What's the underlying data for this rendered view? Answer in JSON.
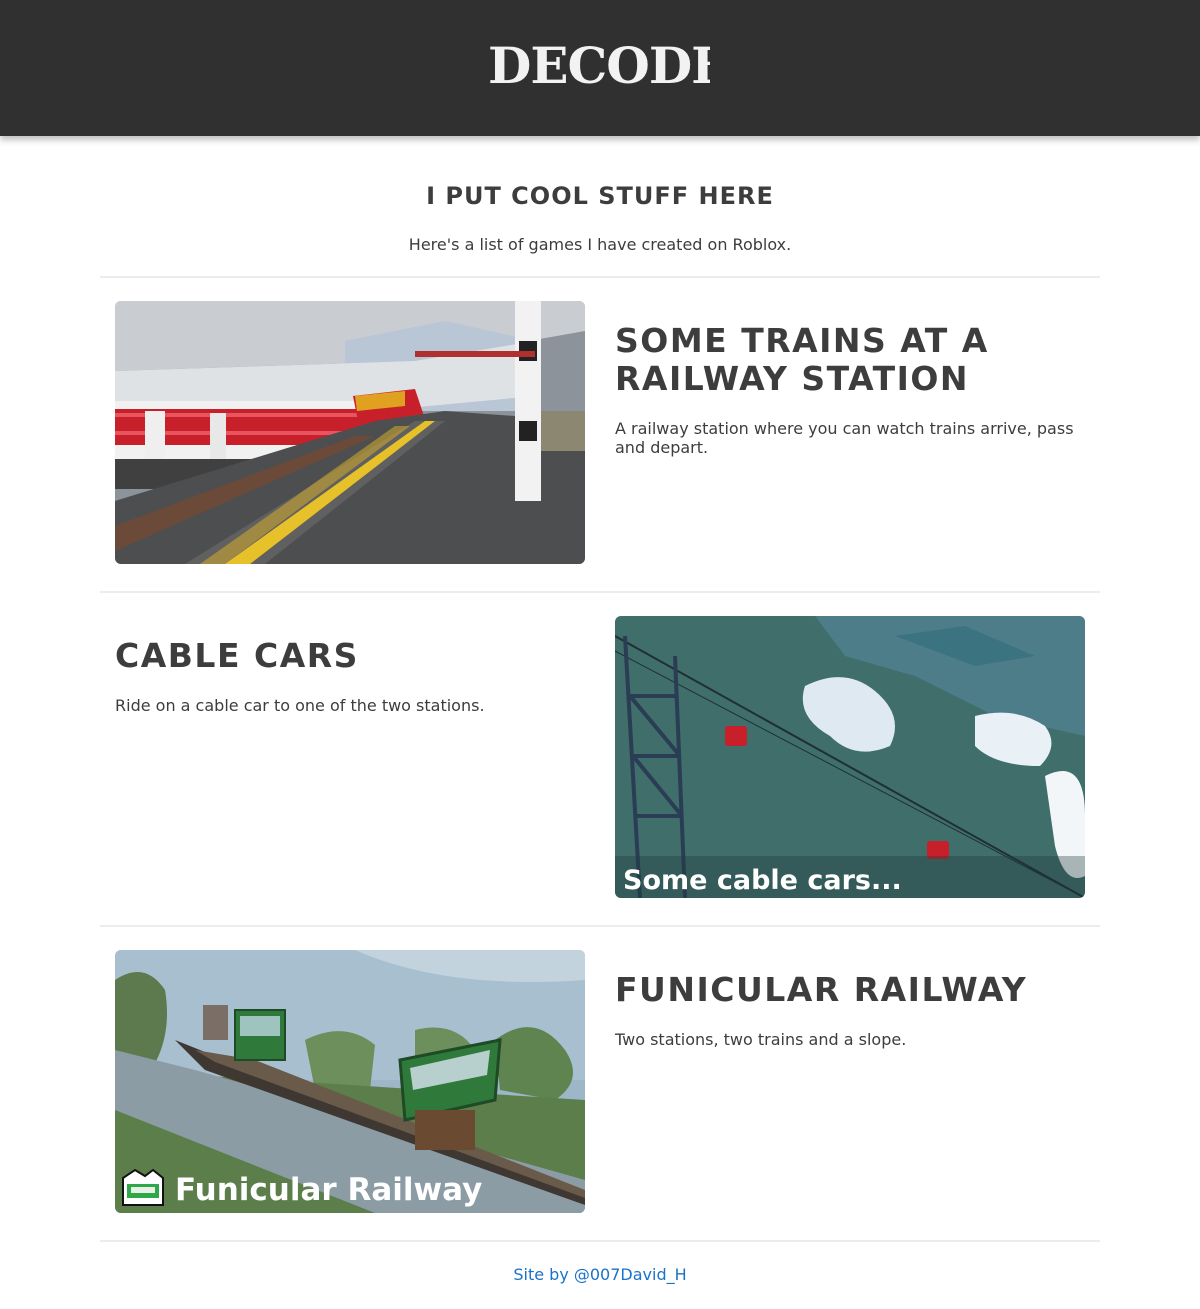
{
  "header": {
    "logo_text": "DECODE"
  },
  "intro": {
    "title": "I PUT COOL STUFF HERE",
    "subtitle": "Here's a list of games I have created on Roblox."
  },
  "games": [
    {
      "title": "SOME TRAINS AT A RAILWAY STATION",
      "description": "A railway station where you can watch trains arrive, pass and depart.",
      "image_caption": ""
    },
    {
      "title": "CABLE CARS",
      "description": "Ride on a cable car to one of the two stations.",
      "image_caption": "Some cable cars..."
    },
    {
      "title": "FUNICULAR RAILWAY",
      "description": "Two stations, two trains and a slope.",
      "image_caption": "Funicular Railway"
    }
  ],
  "footer": {
    "credit": "Site by @007David_H"
  },
  "colors": {
    "header_bg": "#303030",
    "text": "#3d3d3d",
    "link": "#1a73c9",
    "divider": "#ececec"
  }
}
